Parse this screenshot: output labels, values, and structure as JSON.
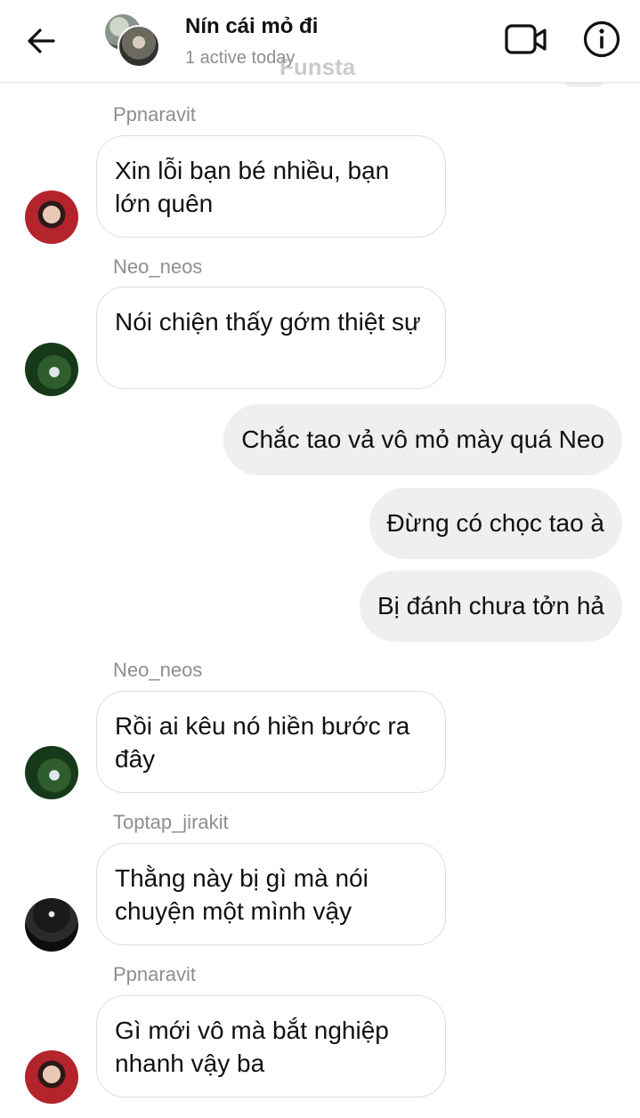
{
  "header": {
    "title": "Nín cái mỏ đi",
    "status": "1 active today",
    "watermark": "Funsta"
  },
  "messages": [
    {
      "type": "in",
      "sender": "Ppnaravit",
      "text": "Xin lỗi bạn bé nhiều, bạn lớn quên",
      "avatar": "red-portrait"
    },
    {
      "type": "in",
      "sender": "Neo_neos",
      "text": "Nói chiện thấy gớm thiệt sự",
      "avatar": "green-garden"
    },
    {
      "type": "out",
      "text": "Chắc tao vả vô mỏ mày quá Neo"
    },
    {
      "type": "out",
      "text": "Đừng có chọc tao à"
    },
    {
      "type": "out",
      "text": "Bị đánh chưa tởn hả"
    },
    {
      "type": "in",
      "sender": "Neo_neos",
      "text": "Rồi ai kêu nó hiền bước ra đây",
      "avatar": "green-garden"
    },
    {
      "type": "in",
      "sender": "Toptap_jirakit",
      "text": "Thằng này bị gì mà nói chuyện một mình vậy",
      "avatar": "dark-stage"
    },
    {
      "type": "in",
      "sender": "Ppnaravit",
      "text": "Gì mới vô mà bắt nghiệp nhanh vậy ba",
      "avatar": "red-portrait"
    }
  ],
  "icons": {
    "back": "arrow-left-icon",
    "video": "video-call-icon",
    "info": "info-icon"
  }
}
